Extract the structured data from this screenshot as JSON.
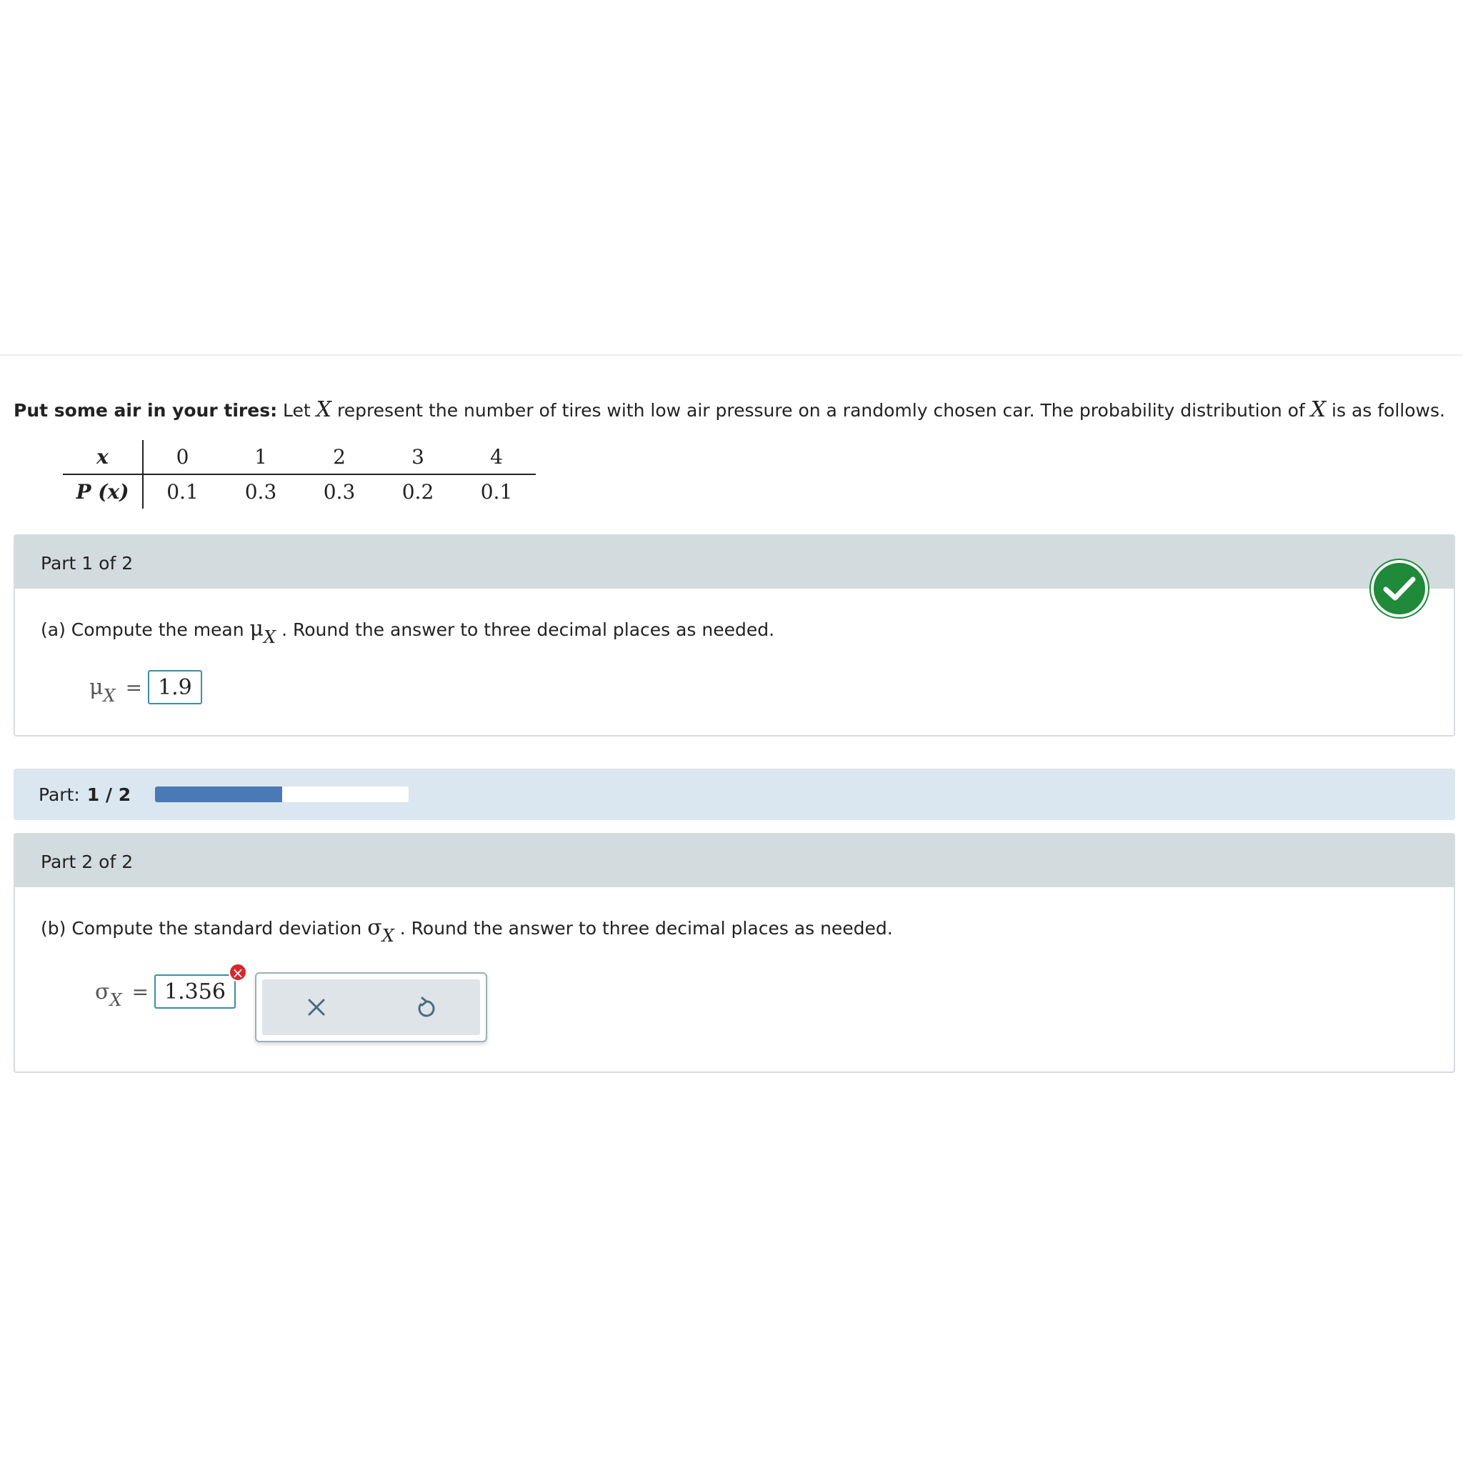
{
  "intro": {
    "bold_lead": "Put some air in your tires:",
    "text_1": " Let ",
    "var_X": "X",
    "text_2": " represent the number of tires with low air pressure on a randomly chosen car. The probability distribution of ",
    "text_3": " is as follows."
  },
  "distribution": {
    "x_header": "x",
    "p_header": "P (x)",
    "x_values": [
      "0",
      "1",
      "2",
      "3",
      "4"
    ],
    "p_values": [
      "0.1",
      "0.3",
      "0.3",
      "0.2",
      "0.1"
    ]
  },
  "part1": {
    "header": "Part 1 of 2",
    "question_pre": "(a) Compute the mean ",
    "symbol": "μ",
    "sub": "X",
    "question_post": " . Round the answer to three decimal places as needed.",
    "equals": "=",
    "answer": "1.9",
    "status": "correct"
  },
  "progress": {
    "label": "Part:",
    "value": "1 / 2",
    "fraction": 0.5
  },
  "part2": {
    "header": "Part 2 of 2",
    "question_pre": "(b) Compute the standard deviation ",
    "symbol": "σ",
    "sub": "X",
    "question_post": " . Round the answer to three decimal places as needed.",
    "equals": "=",
    "answer": "1.356",
    "status": "incorrect",
    "error_mark": "×"
  },
  "icons": {
    "correct": "check-icon",
    "incorrect": "error-x-icon",
    "clear": "clear-x-icon",
    "undo": "undo-icon"
  },
  "colors": {
    "correct_green": "#1f8a3a",
    "error_red": "#d9262c",
    "progress_fill": "#4a7ab5",
    "part_header_bg": "#d2dbde",
    "progress_bg": "#dae6f0"
  }
}
